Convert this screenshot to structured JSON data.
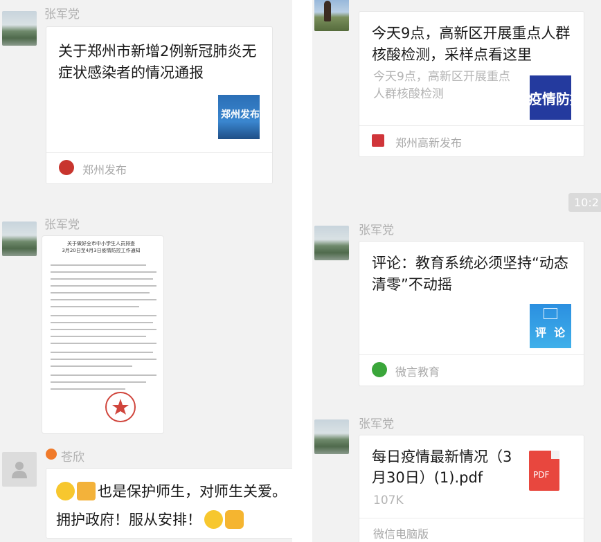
{
  "left": {
    "messages": [
      {
        "sender": "张军党",
        "card": {
          "title_line1": "关于郑州市新增2例新冠肺炎无",
          "title_line2": "症状感染者的情况通报",
          "thumb_text": "郑州发布",
          "source": "郑州发布"
        }
      },
      {
        "sender": "张军党",
        "doc": {
          "heading_line1": "关于做好全市中小学生人员排查",
          "heading_line2": "3月20日至4月3日疫情防控工作通知"
        }
      },
      {
        "sender": "苍欣",
        "text": {
          "line1": "也是保护师生，对师生关爱。",
          "line2": "拥护政府！服从安排！"
        }
      }
    ]
  },
  "right": {
    "time": "10:2",
    "messages": [
      {
        "card": {
          "title_line1": "今天9点，高新区开展重点人群",
          "title_line2": "核酸检测，采样点看这里",
          "desc_line1": "今天9点，高新区开展重点",
          "desc_line2": "人群核酸检测",
          "thumb_text": "疫情防控",
          "source": "郑州高新发布"
        }
      },
      {
        "sender": "张军党",
        "card": {
          "title_line1": "评论：教育系统必须坚持“动态",
          "title_line2": "清零”不动摇",
          "thumb_text": "评  论",
          "source": "微言教育"
        }
      },
      {
        "sender": "张军党",
        "file": {
          "name_line1": "每日疫情最新情况（3",
          "name_line2": "月30日）(1).pdf",
          "size": "107K",
          "type_label": "PDF",
          "source": "微信电脑版"
        }
      }
    ]
  }
}
